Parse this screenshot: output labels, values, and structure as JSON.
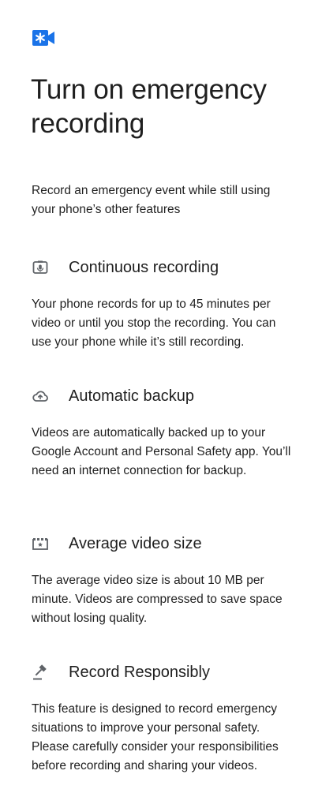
{
  "header": {
    "icon": "emergency-video-icon",
    "accent_color": "#1a73e8",
    "title": "Turn on emergency recording"
  },
  "intro": "Record an emergency event while still using your phone’s other features",
  "sections": [
    {
      "icon": "phone-recording-icon",
      "title": "Continuous recording",
      "body": "Your phone records for up to 45 minutes per video or until you stop the recording. You can use your phone while it’s still recording."
    },
    {
      "icon": "cloud-upload-icon",
      "title": "Automatic backup",
      "body": "Videos are automatically backed up to your Google Account and Personal Safety app. You’ll need an internet connection for backup."
    },
    {
      "icon": "video-file-icon",
      "title": "Average video size",
      "body": "The average video size is about 10 MB per minute. Videos are compressed to save space without losing quality."
    },
    {
      "icon": "gavel-icon",
      "title": "Record Responsibly",
      "body": "This feature is designed to record emergency situations to improve your personal safety. Please carefully consider your responsibilities before recording and sharing your videos."
    }
  ]
}
